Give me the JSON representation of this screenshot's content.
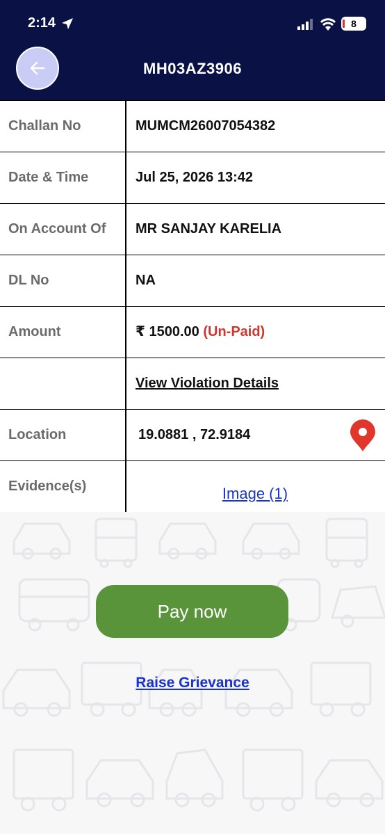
{
  "status_bar": {
    "time": "2:14",
    "battery": "8"
  },
  "header": {
    "title": "MH03AZ3906"
  },
  "details": {
    "challan_label": "Challan No",
    "challan_value": "MUMCM26007054382",
    "datetime_label": "Date & Time",
    "datetime_value": "Jul 25, 2026 13:42",
    "account_label": "On Account Of",
    "account_value": "MR SANJAY KARELIA",
    "dl_label": "DL No",
    "dl_value": "NA",
    "amount_label": "Amount",
    "amount_value": "₹ 1500.00",
    "amount_status": "(Un-Paid)",
    "violation_link": "View Violation Details",
    "location_label": "Location",
    "location_value": "19.0881 ,  72.9184",
    "evidence_label": "Evidence(s)",
    "evidence_link": "Image (1)"
  },
  "actions": {
    "pay_label": "Pay now",
    "grievance_label": "Raise Grievance"
  },
  "colors": {
    "header_bg": "#0a1145",
    "pay_button": "#5a943a",
    "link": "#1a33c9",
    "unpaid": "#d0362e",
    "pin": "#e0362b"
  }
}
